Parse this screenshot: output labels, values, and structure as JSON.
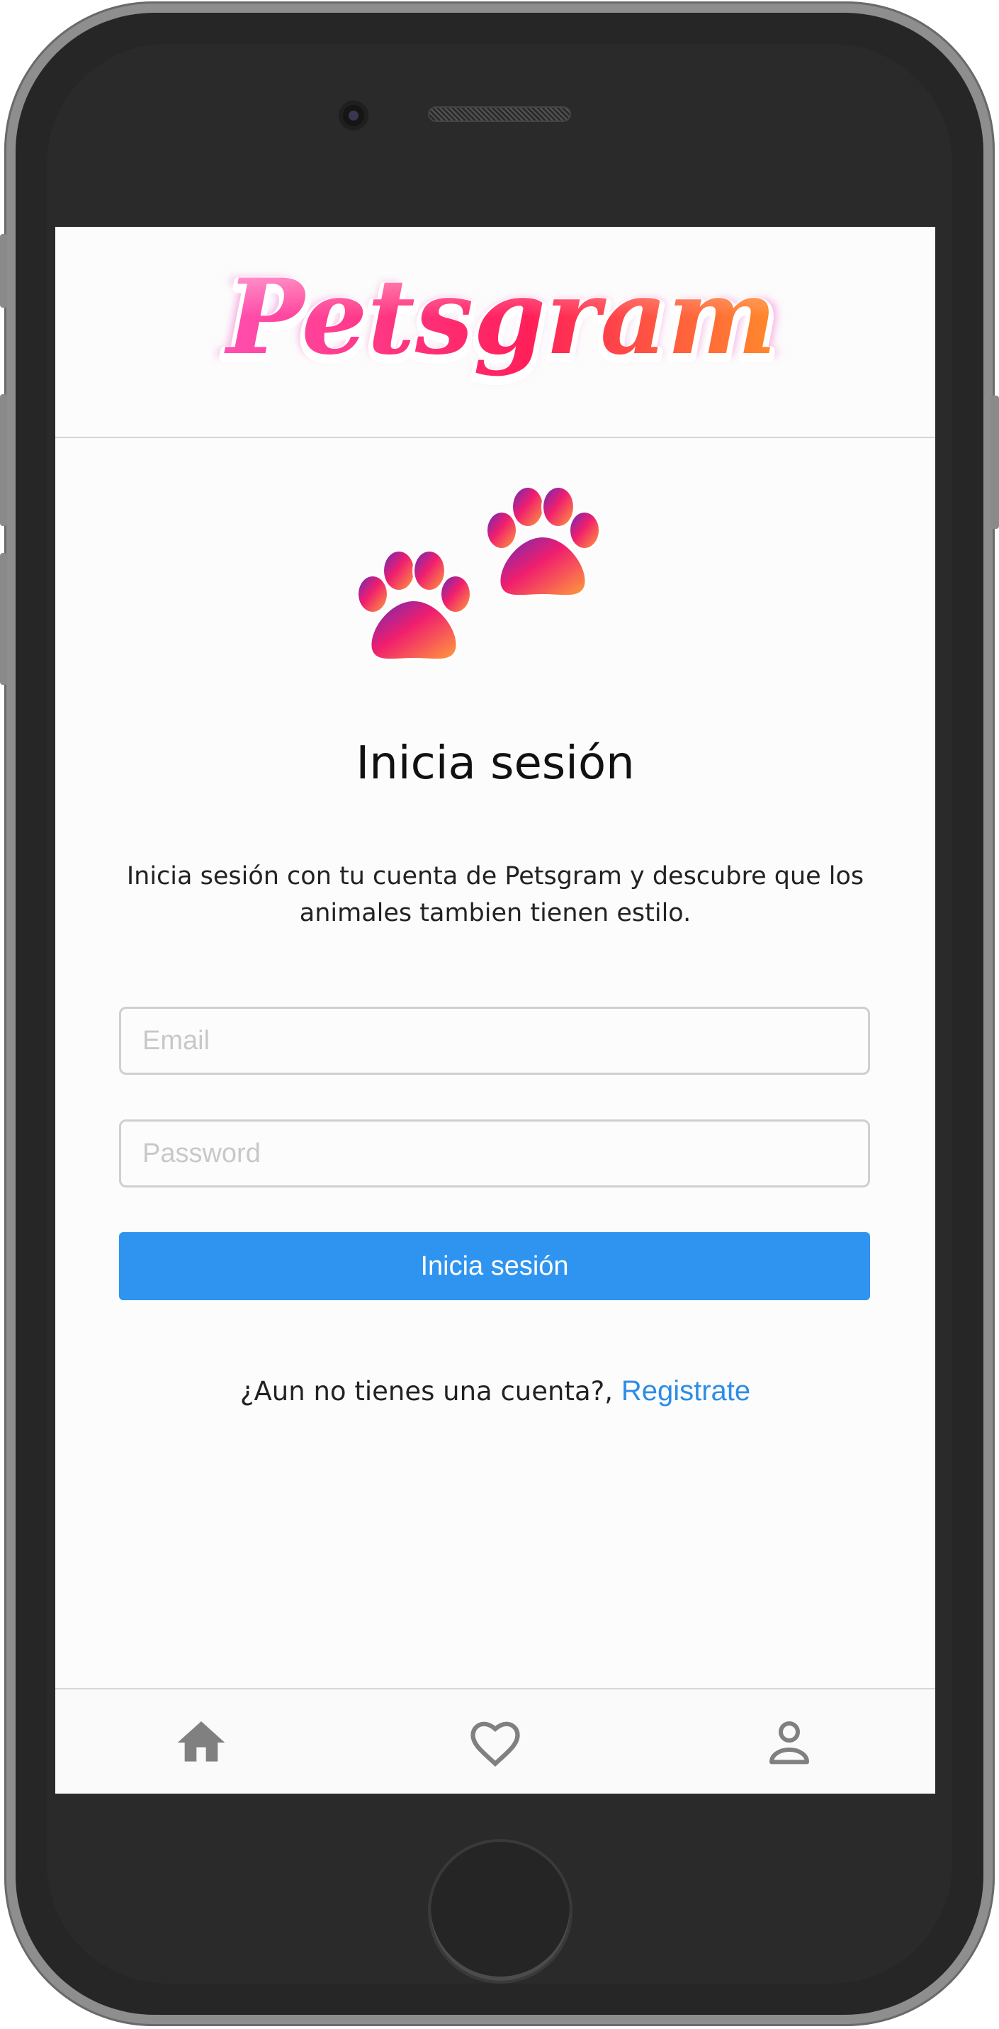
{
  "app": {
    "logo_text": "Petsgram",
    "brand_gradient": [
      "#e0197e",
      "#ff3d6e",
      "#ff8a2a"
    ]
  },
  "login": {
    "title": "Inicia sesión",
    "description": "Inicia sesión con tu cuenta de Petsgram y descubre que los animales tambien tienen estilo.",
    "email_placeholder": "Email",
    "password_placeholder": "Password",
    "submit_label": "Inicia sesión",
    "register_prompt": "¿Aun no tienes una cuenta?, ",
    "register_link": "Registrate"
  },
  "bottom_nav": {
    "items": [
      {
        "icon": "home-icon"
      },
      {
        "icon": "heart-icon"
      },
      {
        "icon": "user-icon"
      }
    ]
  },
  "colors": {
    "primary_button": "#2f94f0",
    "link": "#2b8de8",
    "nav_icon": "#808080"
  }
}
